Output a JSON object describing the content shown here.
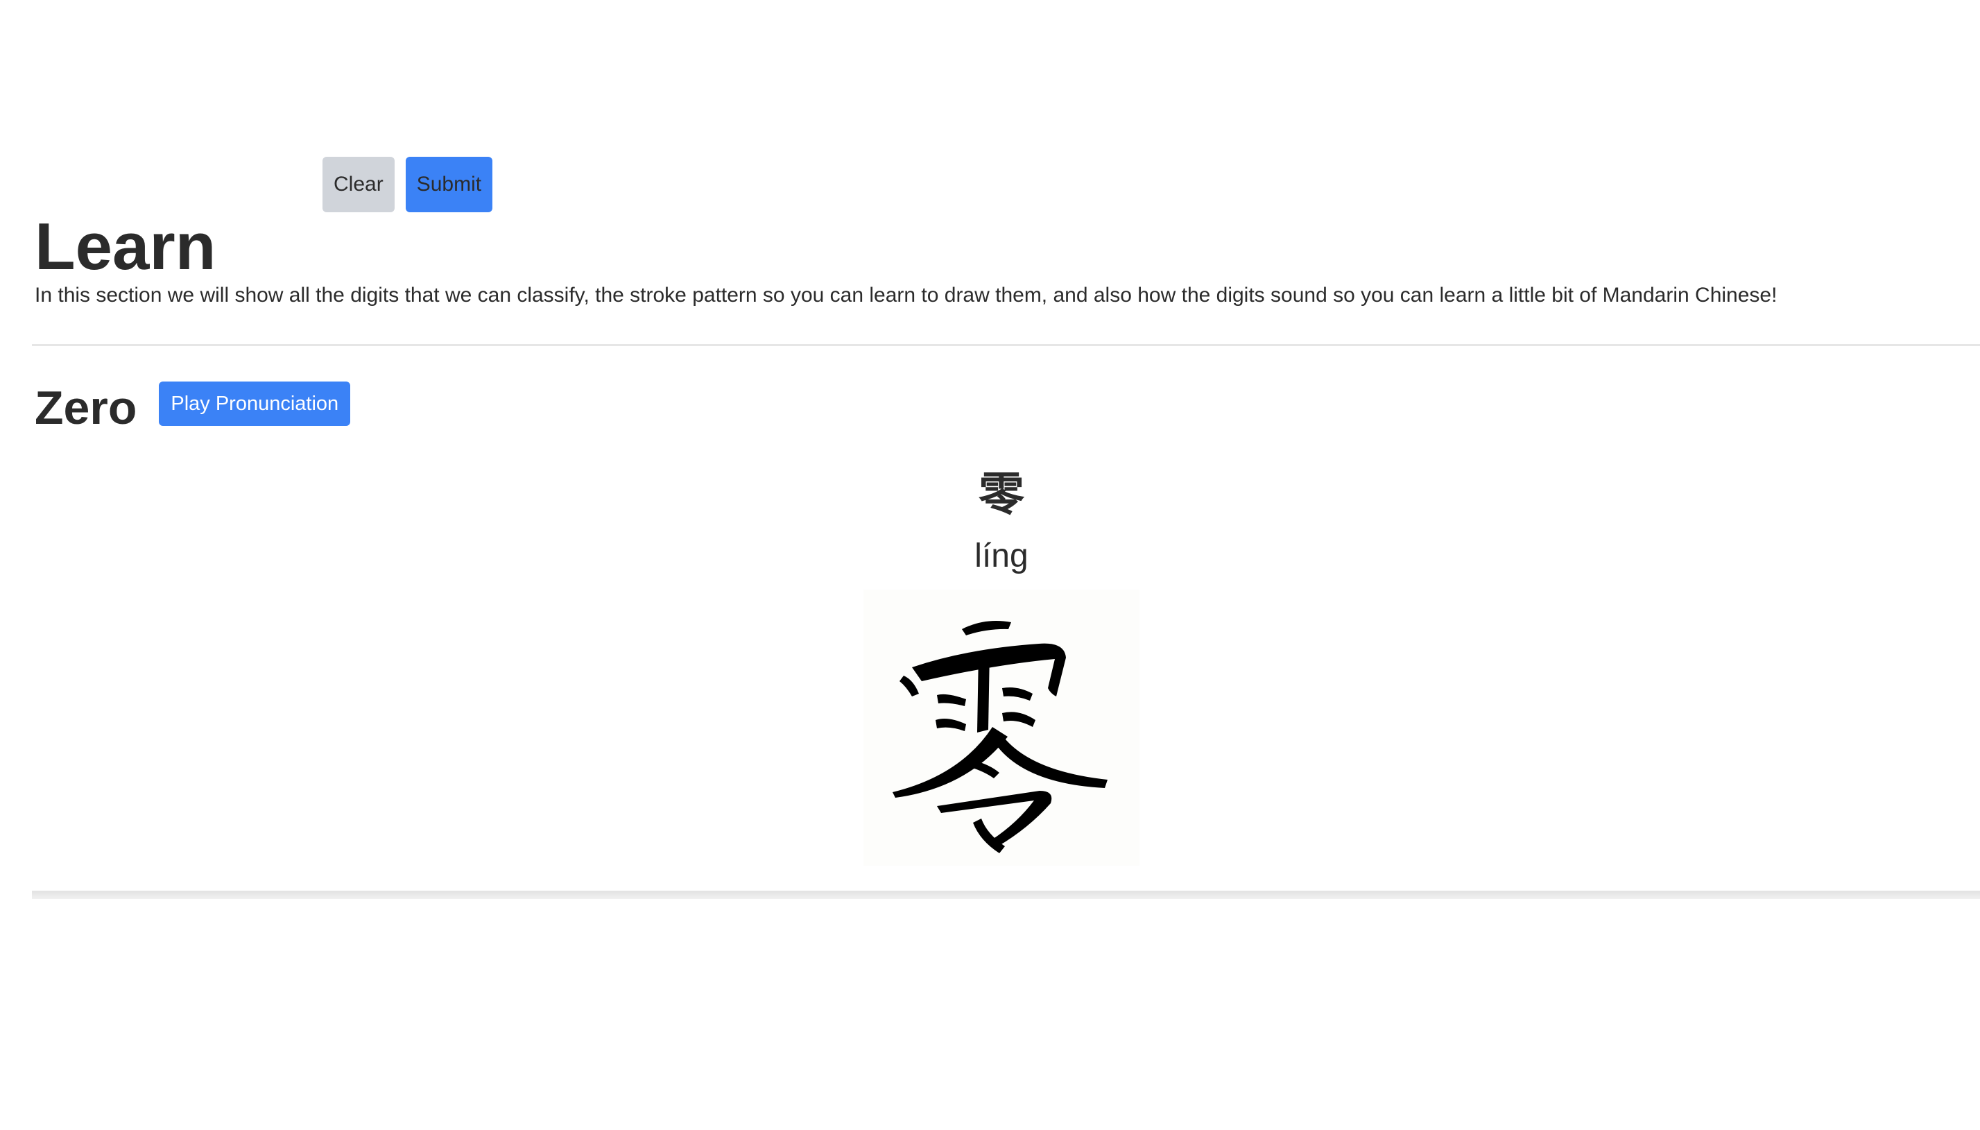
{
  "toolbar": {
    "clear_label": "Clear",
    "submit_label": "Submit"
  },
  "learn": {
    "title": "Learn",
    "description": "In this section we will show all the digits that we can classify, the stroke pattern so you can learn to draw them, and also how the digits sound so you can learn a little bit of Mandarin Chinese!"
  },
  "digits": [
    {
      "name": "Zero",
      "play_label": "Play Pronunciation",
      "character": "零",
      "pinyin": "líng"
    }
  ],
  "colors": {
    "primary": "#3b82f6",
    "secondary": "#d0d4da",
    "text": "#2b2b2b",
    "divider": "#e6e6e6"
  }
}
